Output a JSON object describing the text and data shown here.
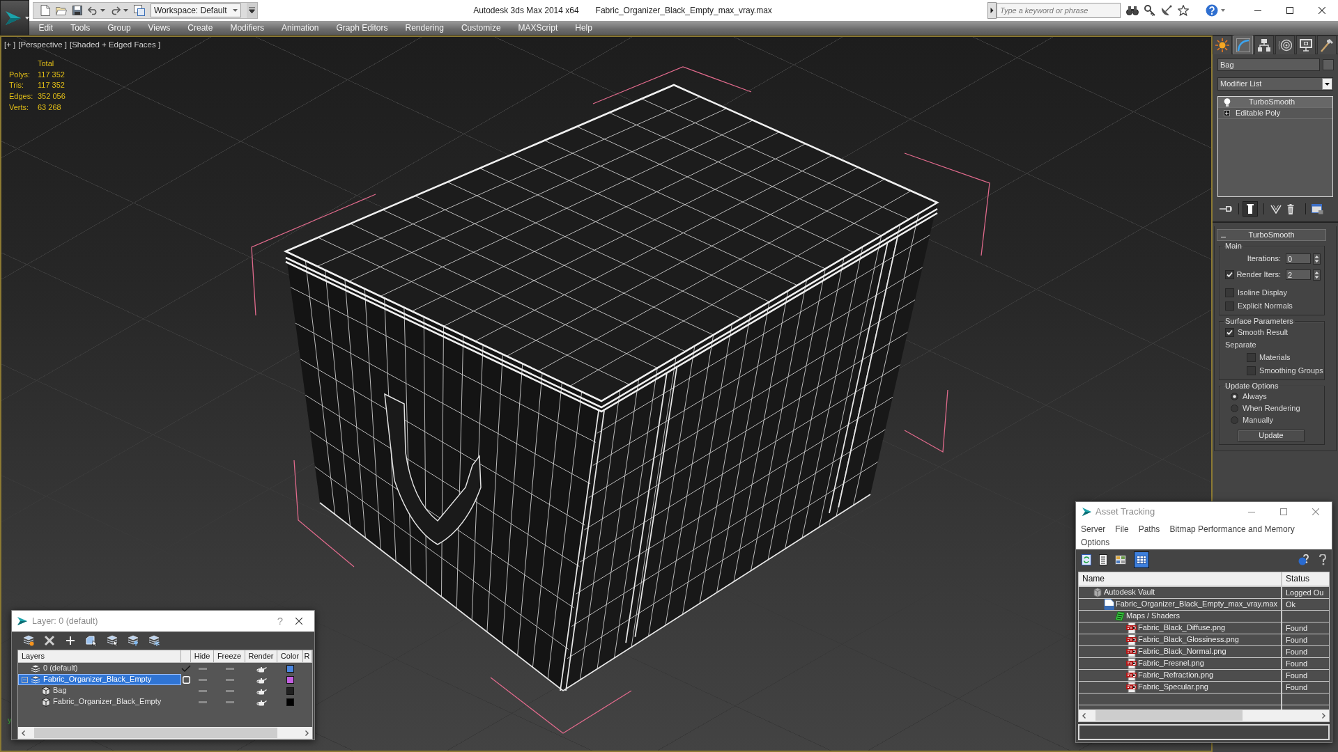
{
  "title_bar": {
    "workspace": "Workspace: Default",
    "app_title": "Autodesk 3ds Max 2014 x64",
    "file_title": "Fabric_Organizer_Black_Empty_max_vray.max",
    "search": {
      "placeholder": "Type a keyword or phrase"
    }
  },
  "menu": [
    "Edit",
    "Tools",
    "Group",
    "Views",
    "Create",
    "Modifiers",
    "Animation",
    "Graph Editors",
    "Rendering",
    "Customize",
    "MAXScript",
    "Help"
  ],
  "viewport": {
    "labels": [
      "[+ ]",
      "[Perspective ]",
      "[Shaded + Edged Faces ]"
    ],
    "stats": {
      "header": "Total",
      "rows": [
        {
          "label": "Polys:",
          "value": "117 352"
        },
        {
          "label": "Tris:",
          "value": "117 352"
        },
        {
          "label": "Edges:",
          "value": "352 056"
        },
        {
          "label": "Verts:",
          "value": "63 268"
        }
      ]
    },
    "axis_label": "y"
  },
  "command_panel": {
    "tabs": [
      {
        "kind": "create",
        "selected": false
      },
      {
        "kind": "modify",
        "selected": true
      },
      {
        "kind": "hierarchy",
        "selected": false
      },
      {
        "kind": "motion",
        "selected": false
      },
      {
        "kind": "display",
        "selected": false
      },
      {
        "kind": "utilities",
        "selected": false
      }
    ],
    "object_name": "Bag",
    "modifier_list": "Modifier List",
    "stack": [
      {
        "kind": "modifier",
        "name": "TurboSmooth",
        "on": true,
        "selected": true
      },
      {
        "kind": "base",
        "name": "Editable Poly",
        "expanded": false,
        "selected": false
      }
    ],
    "stack_tools": [
      {
        "kind": "pin",
        "selected": false
      },
      {
        "kind": "result",
        "selected": true
      },
      {
        "kind": "unique",
        "selected": false
      },
      {
        "kind": "remove",
        "selected": false
      },
      {
        "kind": "configure",
        "selected": false
      }
    ],
    "rollout": {
      "title": "TurboSmooth",
      "expanded": true,
      "groups": [
        {
          "title": "Main",
          "items": [
            {
              "kind": "spinner",
              "label": "Iterations:",
              "value": "0"
            },
            {
              "kind": "togglespinner",
              "label": "Render Iters:",
              "value": "2",
              "checked": true
            },
            {
              "kind": "checkbox",
              "label": "Isoline Display",
              "checked": false
            },
            {
              "kind": "checkbox",
              "label": "Explicit Normals",
              "checked": false
            }
          ]
        },
        {
          "title": "Surface Parameters",
          "items": [
            {
              "kind": "checkbox",
              "label": "Smooth Result",
              "checked": true
            },
            {
              "kind": "text",
              "label": "Separate"
            },
            {
              "kind": "subcheckbox",
              "label": "Materials",
              "checked": false
            },
            {
              "kind": "subcheckbox",
              "label": "Smoothing Groups",
              "checked": false
            }
          ]
        },
        {
          "title": "Update Options",
          "items": [
            {
              "kind": "radio",
              "label": "Always",
              "selected": true
            },
            {
              "kind": "radio",
              "label": "When Rendering",
              "selected": false
            },
            {
              "kind": "radio",
              "label": "Manually",
              "selected": false
            },
            {
              "kind": "button",
              "label": "Update"
            }
          ]
        }
      ]
    }
  },
  "layer_dialog": {
    "title": "Layer: 0 (default)",
    "help": "?",
    "columns": [
      "Layers",
      "Hide",
      "Freeze",
      "Render",
      "Color",
      "R"
    ],
    "layers": [
      {
        "kind": "layer",
        "name": "0 (default)",
        "current": true,
        "selected": false,
        "hidden": false,
        "frozen": false,
        "renderable": true,
        "color": "#4a86e0"
      },
      {
        "kind": "layer",
        "name": "Fabric_Organizer_Black_Empty",
        "current": false,
        "selected": true,
        "expanded": true,
        "hidden": false,
        "frozen": false,
        "renderable": true,
        "color": "#c25ee0",
        "children": [
          {
            "kind": "object",
            "name": "Bag",
            "selected": false,
            "hidden": false,
            "frozen": false,
            "renderable": true,
            "color": "#202020"
          },
          {
            "kind": "object",
            "name": "Fabric_Organizer_Black_Empty",
            "selected": false,
            "hidden": false,
            "frozen": false,
            "renderable": true,
            "color": "#000000"
          }
        ]
      }
    ]
  },
  "asset_tracking": {
    "title": "Asset Tracking",
    "menu": [
      "Server",
      "File",
      "Paths",
      "Bitmap Performance and Memory",
      "Options"
    ],
    "tools": [
      {
        "kind": "refresh",
        "selected": false
      },
      {
        "kind": "list",
        "selected": false
      },
      {
        "kind": "thumbnails",
        "selected": false
      },
      {
        "kind": "table",
        "selected": true
      }
    ],
    "columns": [
      "Name",
      "Status"
    ],
    "tree": [
      {
        "kind": "vault",
        "name": "Autodesk Vault",
        "status": "Logged Ou",
        "children": [
          {
            "kind": "scene",
            "name": "Fabric_Organizer_Black_Empty_max_vray.max",
            "status": "Ok",
            "children": [
              {
                "kind": "maps",
                "name": "Maps / Shaders",
                "children": [
                  {
                    "kind": "image",
                    "name": "Fabric_Black_Diffuse.png",
                    "status": "Found"
                  },
                  {
                    "kind": "image",
                    "name": "Fabric_Black_Glossiness.png",
                    "status": "Found"
                  },
                  {
                    "kind": "image",
                    "name": "Fabric_Black_Normal.png",
                    "status": "Found"
                  },
                  {
                    "kind": "image",
                    "name": "Fabric_Fresnel.png",
                    "status": "Found"
                  },
                  {
                    "kind": "image",
                    "name": "Fabric_Refraction.png",
                    "status": "Found"
                  },
                  {
                    "kind": "image",
                    "name": "Fabric_Specular.png",
                    "status": "Found"
                  }
                ]
              }
            ]
          }
        ]
      }
    ]
  }
}
